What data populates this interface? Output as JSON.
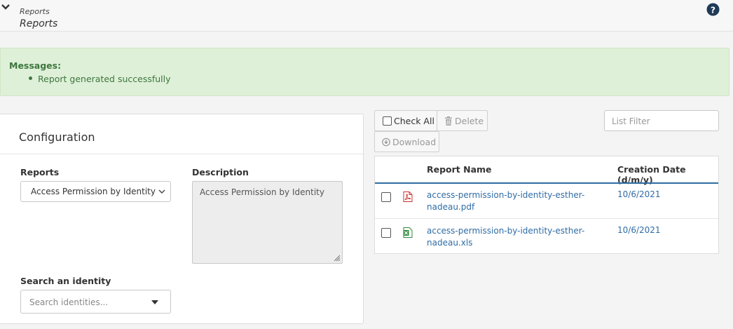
{
  "header": {
    "breadcrumb": "Reports",
    "title": "Reports"
  },
  "messages": {
    "title": "Messages:",
    "items": [
      "Report generated successfully"
    ]
  },
  "configuration": {
    "title": "Configuration",
    "reports_label": "Reports",
    "reports_selected": "Access Permission by Identity",
    "description_label": "Description",
    "description_value": "Access Permission by Identity",
    "search_label": "Search an identity",
    "search_placeholder": "Search identities..."
  },
  "toolbar": {
    "check_all": "Check All",
    "delete": "Delete",
    "download": "Download",
    "filter_placeholder": "List Filter"
  },
  "table": {
    "columns": [
      "Report Name",
      "Creation Date (d/m/y)"
    ],
    "rows": [
      {
        "name": "access-permission-by-identity-esther-nadeau.pdf",
        "date": "10/6/2021",
        "icon": "pdf-file-icon"
      },
      {
        "name": "access-permission-by-identity-esther-nadeau.xls",
        "date": "10/6/2021",
        "icon": "excel-file-icon"
      }
    ]
  },
  "colors": {
    "success_bg": "#dff0d8",
    "success_text": "#3c763d",
    "link": "#2f6ca5",
    "table_header_line": "#2e6da4"
  }
}
